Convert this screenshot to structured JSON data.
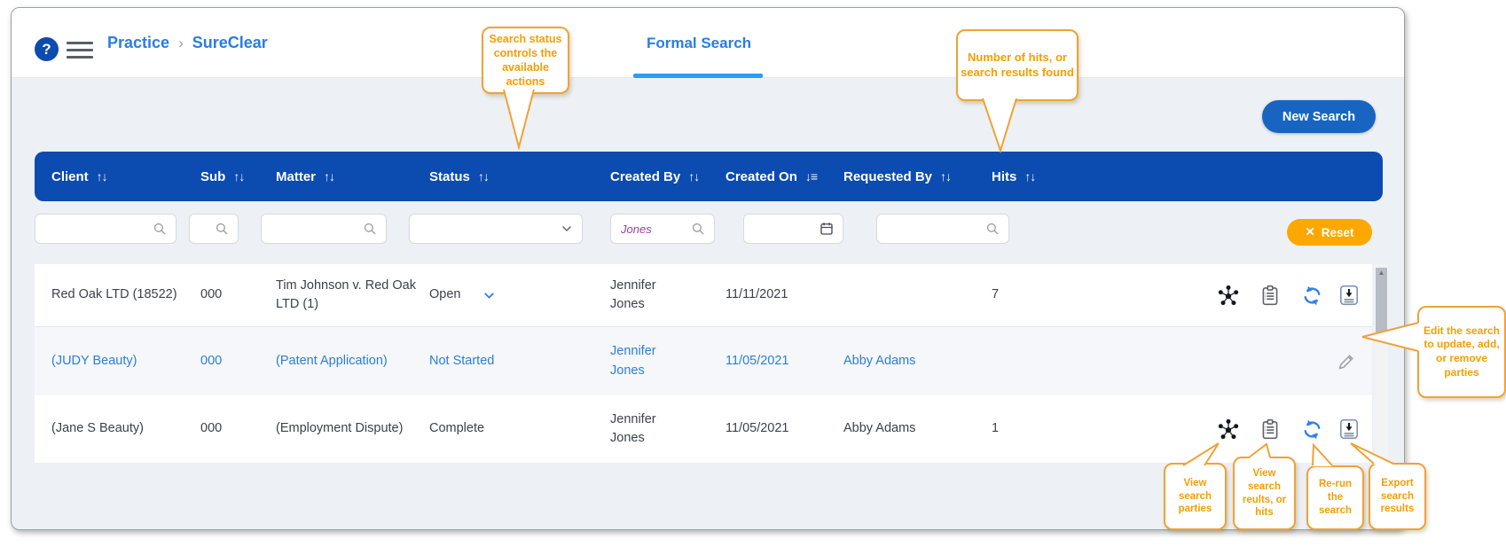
{
  "header": {
    "help_label": "?",
    "breadcrumb": {
      "items": [
        "Practice",
        "SureClear"
      ],
      "separator": "›"
    },
    "tab_label": "Formal Search"
  },
  "buttons": {
    "new_search": "New Search",
    "reset": "Reset",
    "reset_x": "✕"
  },
  "icons": {
    "sort_both": "↑↓",
    "sort_desc": "↓≡",
    "scroll_up_arrow": "▲"
  },
  "table": {
    "columns": [
      {
        "label": "Client",
        "sort": "unsorted"
      },
      {
        "label": "Sub",
        "sort": "unsorted"
      },
      {
        "label": "Matter",
        "sort": "unsorted"
      },
      {
        "label": "Status",
        "sort": "unsorted"
      },
      {
        "label": "Created By",
        "sort": "unsorted"
      },
      {
        "label": "Created On",
        "sort": "descending"
      },
      {
        "label": "Requested By",
        "sort": "unsorted"
      },
      {
        "label": "Hits",
        "sort": "unsorted"
      }
    ],
    "filters": {
      "created_by_value": "Jones"
    },
    "rows": [
      {
        "client": "Red Oak LTD (18522)",
        "sub": "000",
        "matter": "Tim Johnson v. Red Oak LTD (1)",
        "status": "Open",
        "created_by": "Jennifer Jones",
        "created_on": "11/11/2021",
        "requested_by": "",
        "hits": "7"
      },
      {
        "client": "(JUDY Beauty)",
        "sub": "000",
        "matter": "(Patent Application)",
        "status": "Not Started",
        "created_by": "Jennifer Jones",
        "created_on": "11/05/2021",
        "requested_by": "Abby Adams",
        "hits": ""
      },
      {
        "client": "(Jane S Beauty)",
        "sub": "000",
        "matter": "(Employment Dispute)",
        "status": "Complete",
        "created_by": "Jennifer Jones",
        "created_on": "11/05/2021",
        "requested_by": "Abby Adams",
        "hits": "1"
      }
    ]
  },
  "callouts": {
    "status": "Search status controls the available actions",
    "hits": "Number of hits, or search results found",
    "edit": "Edit the search to update, add, or remove parties",
    "parties": "View search parties",
    "results": "View search reults, or hits",
    "rerun": "Re-run the search",
    "export": "Export search results"
  },
  "colors": {
    "header_bar": "#0c4bb0",
    "accent_blue": "#2a7de1",
    "tab_underline": "#2f9bf1",
    "new_search_blue": "#1765c1",
    "reset_orange": "#fca800",
    "callout_orange": "#f0a236",
    "callout_text": "#f59e00",
    "row_link_blue": "#2d7ed3",
    "filter_value_purple": "#a9399e"
  }
}
